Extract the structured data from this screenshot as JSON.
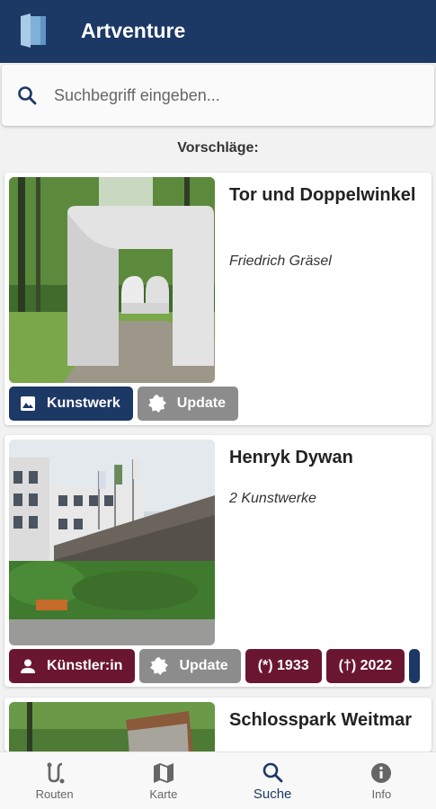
{
  "app": {
    "title": "Artventure"
  },
  "search": {
    "placeholder": "Suchbegriff eingeben..."
  },
  "suggestions_label": "Vorschläge:",
  "cards": [
    {
      "title": "Tor und Doppelwinkel",
      "subtitle": "Friedrich Gräsel",
      "chips": [
        "Kunstwerk",
        "Update"
      ]
    },
    {
      "title": "Henryk Dywan",
      "subtitle": "2 Kunstwerke",
      "chips": [
        "Künstler:in",
        "Update",
        "(*) 1933",
        "(†) 2022"
      ]
    },
    {
      "title": "Schlosspark Weitmar"
    }
  ],
  "nav": [
    {
      "label": "Routen",
      "icon": "route-icon"
    },
    {
      "label": "Karte",
      "icon": "map-icon"
    },
    {
      "label": "Suche",
      "icon": "search-icon"
    },
    {
      "label": "Info",
      "icon": "info-icon"
    }
  ],
  "colors": {
    "primary": "#1c3865",
    "maroon": "#6b1631",
    "grey": "#8c8c8c"
  }
}
